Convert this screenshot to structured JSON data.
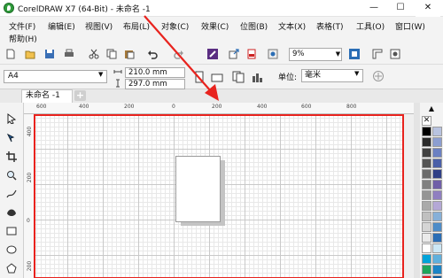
{
  "title": "CorelDRAW X7 (64-Bit) - 未命名 -1",
  "window_controls": {
    "minimize": "—",
    "maximize": "☐",
    "close": "✕"
  },
  "menu": [
    "文件(F)",
    "编辑(E)",
    "视图(V)",
    "布局(L)",
    "对象(C)",
    "效果(C)",
    "位图(B)",
    "文本(X)",
    "表格(T)",
    "工具(O)",
    "窗口(W)",
    "帮助(H)"
  ],
  "toolbar": {
    "zoom_value": "9%"
  },
  "property_bar": {
    "paper_size": "A4",
    "width": "210.0 mm",
    "height": "297.0 mm",
    "unit_label": "单位:",
    "unit_value": "毫米"
  },
  "document_tab": {
    "label": "未命名 -1",
    "add_label": "+"
  },
  "rulers": {
    "top_ticks": [
      "600",
      "400",
      "200",
      "0",
      "200",
      "400",
      "600",
      "800"
    ],
    "left_ticks": [
      "400",
      "200",
      "0",
      "200"
    ]
  },
  "palette": {
    "no_color": "✕",
    "colors": [
      "#000000",
      "#2b2b2b",
      "#404040",
      "#555555",
      "#6a6a6a",
      "#808080",
      "#959595",
      "#aaaaaa",
      "#c0c0c0",
      "#d5d5d5",
      "#eaeaea",
      "#ffffff",
      "#00a3d9",
      "#1fa55b",
      "#e31e24",
      "#b8c3e0",
      "#8c9ed1",
      "#6b80c2",
      "#4a5fa8",
      "#2f3f86",
      "#6f5ea8",
      "#8f7fc0",
      "#b4a8d6",
      "#86b0d8",
      "#4d8cc8",
      "#2a6db5",
      "#cce7f5",
      "#5fb0dd",
      "#1b84c6",
      "#0f5a9a"
    ]
  },
  "annotation": {
    "highlight_color": "#e8231e"
  }
}
